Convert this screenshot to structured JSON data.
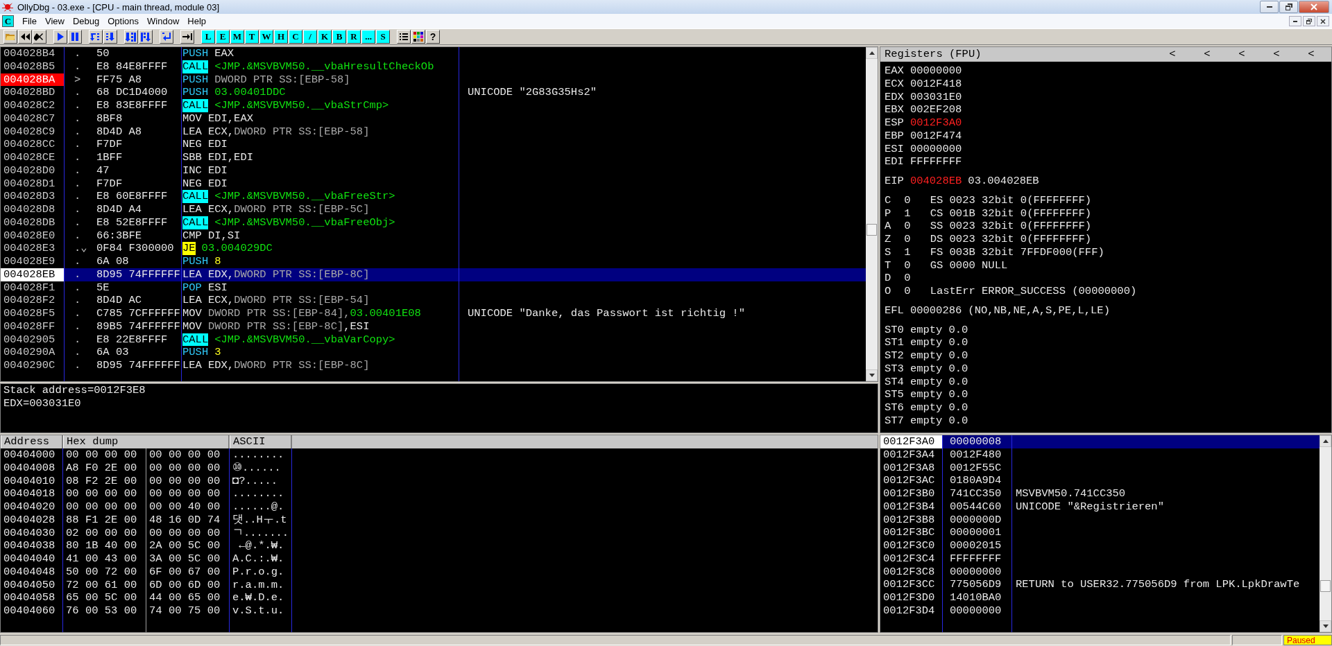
{
  "window": {
    "title": "OllyDbg - 03.exe - [CPU - main thread, module 03]"
  },
  "menu": {
    "icon_letter": "C",
    "items": [
      "File",
      "View",
      "Debug",
      "Options",
      "Window",
      "Help"
    ]
  },
  "toolbar": {
    "letters": [
      "L",
      "E",
      "M",
      "T",
      "W",
      "H",
      "C",
      "/",
      "K",
      "B",
      "R",
      "...",
      "S"
    ],
    "help": "?"
  },
  "disassembly": {
    "rows": [
      {
        "address": "004028B4",
        "marker": ".",
        "hex": "50",
        "mnemonic": "PUSH",
        "kind": "stack",
        "operands": [
          {
            "text": "EAX",
            "kind": "reg"
          }
        ],
        "breakpoint": false,
        "current": false,
        "selected": false
      },
      {
        "address": "004028B5",
        "marker": ".",
        "hex": "E8 84E8FFFF",
        "mnemonic": "CALL",
        "kind": "call",
        "operands": [
          {
            "text": "<JMP.&MSVBVM50.__vbaHresultCheckOb",
            "kind": "label"
          }
        ],
        "breakpoint": false,
        "current": false,
        "selected": false
      },
      {
        "address": "004028BA",
        "marker": ">",
        "hex": "FF75 A8",
        "mnemonic": "PUSH",
        "kind": "stack",
        "operands": [
          {
            "text": "DWORD PTR SS:[EBP-58]",
            "kind": "mem"
          }
        ],
        "breakpoint": true,
        "current": false,
        "selected": false
      },
      {
        "address": "004028BD",
        "marker": ".",
        "hex": "68 DC1D4000",
        "mnemonic": "PUSH",
        "kind": "stack",
        "operands": [
          {
            "text": "03.00401DDC",
            "kind": "label"
          }
        ],
        "comment": "UNICODE \"2G83G35Hs2\"",
        "breakpoint": false,
        "current": false,
        "selected": false
      },
      {
        "address": "004028C2",
        "marker": ".",
        "hex": "E8 83E8FFFF",
        "mnemonic": "CALL",
        "kind": "call",
        "operands": [
          {
            "text": "<JMP.&MSVBVM50.__vbaStrCmp>",
            "kind": "label"
          }
        ],
        "breakpoint": false,
        "current": false,
        "selected": false
      },
      {
        "address": "004028C7",
        "marker": ".",
        "hex": "8BF8",
        "mnemonic": "MOV",
        "kind": "plain",
        "operands": [
          {
            "text": "EDI,EAX",
            "kind": "reg"
          }
        ],
        "breakpoint": false,
        "current": false,
        "selected": false
      },
      {
        "address": "004028C9",
        "marker": ".",
        "hex": "8D4D A8",
        "mnemonic": "LEA",
        "kind": "plain",
        "operands": [
          {
            "text": "ECX,",
            "kind": "reg"
          },
          {
            "text": "DWORD PTR SS:[EBP-58]",
            "kind": "mem"
          }
        ],
        "breakpoint": false,
        "current": false,
        "selected": false
      },
      {
        "address": "004028CC",
        "marker": ".",
        "hex": "F7DF",
        "mnemonic": "NEG",
        "kind": "plain",
        "operands": [
          {
            "text": "EDI",
            "kind": "reg"
          }
        ],
        "breakpoint": false,
        "current": false,
        "selected": false
      },
      {
        "address": "004028CE",
        "marker": ".",
        "hex": "1BFF",
        "mnemonic": "SBB",
        "kind": "plain",
        "operands": [
          {
            "text": "EDI,EDI",
            "kind": "reg"
          }
        ],
        "breakpoint": false,
        "current": false,
        "selected": false
      },
      {
        "address": "004028D0",
        "marker": ".",
        "hex": "47",
        "mnemonic": "INC",
        "kind": "plain",
        "operands": [
          {
            "text": "EDI",
            "kind": "reg"
          }
        ],
        "breakpoint": false,
        "current": false,
        "selected": false
      },
      {
        "address": "004028D1",
        "marker": ".",
        "hex": "F7DF",
        "mnemonic": "NEG",
        "kind": "plain",
        "operands": [
          {
            "text": "EDI",
            "kind": "reg"
          }
        ],
        "breakpoint": false,
        "current": false,
        "selected": false
      },
      {
        "address": "004028D3",
        "marker": ".",
        "hex": "E8 60E8FFFF",
        "mnemonic": "CALL",
        "kind": "call",
        "operands": [
          {
            "text": "<JMP.&MSVBVM50.__vbaFreeStr>",
            "kind": "label"
          }
        ],
        "breakpoint": false,
        "current": false,
        "selected": false
      },
      {
        "address": "004028D8",
        "marker": ".",
        "hex": "8D4D A4",
        "mnemonic": "LEA",
        "kind": "plain",
        "operands": [
          {
            "text": "ECX,",
            "kind": "reg"
          },
          {
            "text": "DWORD PTR SS:[EBP-5C]",
            "kind": "mem"
          }
        ],
        "breakpoint": false,
        "current": false,
        "selected": false
      },
      {
        "address": "004028DB",
        "marker": ".",
        "hex": "E8 52E8FFFF",
        "mnemonic": "CALL",
        "kind": "call",
        "operands": [
          {
            "text": "<JMP.&MSVBVM50.__vbaFreeObj>",
            "kind": "label"
          }
        ],
        "breakpoint": false,
        "current": false,
        "selected": false
      },
      {
        "address": "004028E0",
        "marker": ".",
        "hex": "66:3BFE",
        "mnemonic": "CMP",
        "kind": "plain",
        "operands": [
          {
            "text": "DI,SI",
            "kind": "reg"
          }
        ],
        "breakpoint": false,
        "current": false,
        "selected": false
      },
      {
        "address": "004028E3",
        "marker": ".⌄",
        "hex": "0F84 F300000",
        "mnemonic": "JE",
        "kind": "jump",
        "operands": [
          {
            "text": "03.004029DC",
            "kind": "label"
          }
        ],
        "breakpoint": false,
        "current": false,
        "selected": false
      },
      {
        "address": "004028E9",
        "marker": ".",
        "hex": "6A 08",
        "mnemonic": "PUSH",
        "kind": "stack",
        "operands": [
          {
            "text": "8",
            "kind": "const"
          }
        ],
        "breakpoint": false,
        "current": false,
        "selected": false
      },
      {
        "address": "004028EB",
        "marker": ".",
        "hex": "8D95 74FFFFFF",
        "mnemonic": "LEA",
        "kind": "plain",
        "operands": [
          {
            "text": "EDX,",
            "kind": "reg"
          },
          {
            "text": "DWORD PTR SS:[EBP-8C]",
            "kind": "mem"
          }
        ],
        "breakpoint": false,
        "current": true,
        "selected": true
      },
      {
        "address": "004028F1",
        "marker": ".",
        "hex": "5E",
        "mnemonic": "POP",
        "kind": "stack",
        "operands": [
          {
            "text": "ESI",
            "kind": "reg"
          }
        ],
        "breakpoint": false,
        "current": false,
        "selected": false
      },
      {
        "address": "004028F2",
        "marker": ".",
        "hex": "8D4D AC",
        "mnemonic": "LEA",
        "kind": "plain",
        "operands": [
          {
            "text": "ECX,",
            "kind": "reg"
          },
          {
            "text": "DWORD PTR SS:[EBP-54]",
            "kind": "mem"
          }
        ],
        "breakpoint": false,
        "current": false,
        "selected": false
      },
      {
        "address": "004028F5",
        "marker": ".",
        "hex": "C785 7CFFFFFF",
        "mnemonic": "MOV",
        "kind": "plain",
        "operands": [
          {
            "text": "DWORD PTR SS:[EBP-84],",
            "kind": "mem"
          },
          {
            "text": "03.00401E08",
            "kind": "label"
          }
        ],
        "comment": "UNICODE \"Danke, das Passwort ist richtig !\"",
        "breakpoint": false,
        "current": false,
        "selected": false
      },
      {
        "address": "004028FF",
        "marker": ".",
        "hex": "89B5 74FFFFFF",
        "mnemonic": "MOV",
        "kind": "plain",
        "operands": [
          {
            "text": "DWORD PTR SS:[EBP-8C]",
            "kind": "mem"
          },
          {
            "text": ",ESI",
            "kind": "reg"
          }
        ],
        "breakpoint": false,
        "current": false,
        "selected": false
      },
      {
        "address": "00402905",
        "marker": ".",
        "hex": "E8 22E8FFFF",
        "mnemonic": "CALL",
        "kind": "call",
        "operands": [
          {
            "text": "<JMP.&MSVBVM50.__vbaVarCopy>",
            "kind": "label"
          }
        ],
        "breakpoint": false,
        "current": false,
        "selected": false
      },
      {
        "address": "0040290A",
        "marker": ".",
        "hex": "6A 03",
        "mnemonic": "PUSH",
        "kind": "stack",
        "operands": [
          {
            "text": "3",
            "kind": "const"
          }
        ],
        "breakpoint": false,
        "current": false,
        "selected": false
      },
      {
        "address": "0040290C",
        "marker": ".",
        "hex": "8D95 74FFFFFF",
        "mnemonic": "LEA",
        "kind": "plain",
        "operands": [
          {
            "text": "EDX,",
            "kind": "reg"
          },
          {
            "text": "DWORD PTR SS:[EBP-8C]",
            "kind": "mem"
          }
        ],
        "breakpoint": false,
        "current": false,
        "selected": false
      }
    ]
  },
  "info": [
    "Stack address=0012F3E8",
    "EDX=003031E0"
  ],
  "registers": {
    "title": "Registers (FPU)",
    "arrows": [
      "<",
      "<",
      "<",
      "<",
      "<"
    ],
    "groups": [
      {
        "kind": "general",
        "lines": [
          {
            "name": "EAX",
            "value": "00000000",
            "changed": false
          },
          {
            "name": "ECX",
            "value": "0012F418",
            "changed": false
          },
          {
            "name": "EDX",
            "value": "003031E0",
            "changed": false
          },
          {
            "name": "EBX",
            "value": "002EF208",
            "changed": false
          },
          {
            "name": "ESP",
            "value": "0012F3A0",
            "changed": true
          },
          {
            "name": "EBP",
            "value": "0012F474",
            "changed": false
          },
          {
            "name": "ESI",
            "value": "00000000",
            "changed": false
          },
          {
            "name": "EDI",
            "value": "FFFFFFFF",
            "changed": false
          }
        ]
      },
      {
        "kind": "general",
        "lines": [
          {
            "name": "EIP",
            "value": "004028EB",
            "changed": true,
            "comment": "03.004028EB"
          }
        ]
      },
      {
        "kind": "flags",
        "lines": [
          {
            "name": "C",
            "value": "0",
            "changed": false,
            "comment": "ES 0023 32bit 0(FFFFFFFF)"
          },
          {
            "name": "P",
            "value": "1",
            "changed": false,
            "comment": "CS 001B 32bit 0(FFFFFFFF)"
          },
          {
            "name": "A",
            "value": "0",
            "changed": false,
            "comment": "SS 0023 32bit 0(FFFFFFFF)"
          },
          {
            "name": "Z",
            "value": "0",
            "changed": false,
            "comment": "DS 0023 32bit 0(FFFFFFFF)"
          },
          {
            "name": "S",
            "value": "1",
            "changed": false,
            "comment": "FS 003B 32bit 7FFDF000(FFF)"
          },
          {
            "name": "T",
            "value": "0",
            "changed": false,
            "comment": "GS 0000 NULL"
          },
          {
            "name": "D",
            "value": "0",
            "changed": false
          },
          {
            "name": "O",
            "value": "0",
            "changed": false,
            "comment": "LastErr ERROR_SUCCESS (00000000)"
          }
        ]
      },
      {
        "kind": "general",
        "lines": [
          {
            "name": "EFL",
            "value": "00000286",
            "changed": false,
            "comment": "(NO,NB,NE,A,S,PE,L,LE)"
          }
        ]
      },
      {
        "kind": "general",
        "lines": [
          {
            "name": "ST0",
            "value": "empty",
            "changed": false,
            "comment": "0.0"
          },
          {
            "name": "ST1",
            "value": "empty",
            "changed": false,
            "comment": "0.0"
          },
          {
            "name": "ST2",
            "value": "empty",
            "changed": false,
            "comment": "0.0"
          },
          {
            "name": "ST3",
            "value": "empty",
            "changed": false,
            "comment": "0.0"
          },
          {
            "name": "ST4",
            "value": "empty",
            "changed": false,
            "comment": "0.0"
          },
          {
            "name": "ST5",
            "value": "empty",
            "changed": false,
            "comment": "0.0"
          },
          {
            "name": "ST6",
            "value": "empty",
            "changed": false,
            "comment": "0.0"
          },
          {
            "name": "ST7",
            "value": "empty",
            "changed": false,
            "comment": "0.0"
          }
        ]
      }
    ]
  },
  "dump": {
    "columns": [
      "Address",
      "Hex dump",
      "ASCII"
    ],
    "rows": [
      {
        "address": "00404000",
        "hex": [
          "00 00 00 00",
          "00 00 00 00"
        ],
        "ascii": "........"
      },
      {
        "address": "00404008",
        "hex": [
          "A8 F0 2E 00",
          "00 00 00 00"
        ],
        "ascii": "⑩......"
      },
      {
        "address": "00404010",
        "hex": [
          "08 F2 2E 00",
          "00 00 00 00"
        ],
        "ascii": "◘?....."
      },
      {
        "address": "00404018",
        "hex": [
          "00 00 00 00",
          "00 00 00 00"
        ],
        "ascii": "........"
      },
      {
        "address": "00404020",
        "hex": [
          "00 00 00 00",
          "00 00 40 00"
        ],
        "ascii": "......@."
      },
      {
        "address": "00404028",
        "hex": [
          "88 F1 2E 00",
          "48 16 0D 74"
        ],
        "ascii": "댓..Hㅜ.t"
      },
      {
        "address": "00404030",
        "hex": [
          "02 00 00 00",
          "00 00 00 00"
        ],
        "ascii": "ㄱ......."
      },
      {
        "address": "00404038",
        "hex": [
          "80 1B 40 00",
          "2A 00 5C 00"
        ],
        "ascii": " ←@.*.₩."
      },
      {
        "address": "00404040",
        "hex": [
          "41 00 43 00",
          "3A 00 5C 00"
        ],
        "ascii": "A.C.:.₩."
      },
      {
        "address": "00404048",
        "hex": [
          "50 00 72 00",
          "6F 00 67 00"
        ],
        "ascii": "P.r.o.g."
      },
      {
        "address": "00404050",
        "hex": [
          "72 00 61 00",
          "6D 00 6D 00"
        ],
        "ascii": "r.a.m.m."
      },
      {
        "address": "00404058",
        "hex": [
          "65 00 5C 00",
          "44 00 65 00"
        ],
        "ascii": "e.₩.D.e."
      },
      {
        "address": "00404060",
        "hex": [
          "76 00 53 00",
          "74 00 75 00"
        ],
        "ascii": "v.S.t.u."
      }
    ]
  },
  "stack": {
    "rows": [
      {
        "address": "0012F3A0",
        "value": "00000008",
        "selected": true
      },
      {
        "address": "0012F3A4",
        "value": "0012F480",
        "selected": false
      },
      {
        "address": "0012F3A8",
        "value": "0012F55C",
        "selected": false
      },
      {
        "address": "0012F3AC",
        "value": "0180A9D4",
        "selected": false
      },
      {
        "address": "0012F3B0",
        "value": "741CC350",
        "comment": "MSVBVM50.741CC350",
        "selected": false
      },
      {
        "address": "0012F3B4",
        "value": "00544C60",
        "comment": "UNICODE \"&Registrieren\"",
        "selected": false
      },
      {
        "address": "0012F3B8",
        "value": "0000000D",
        "selected": false
      },
      {
        "address": "0012F3BC",
        "value": "00000001",
        "selected": false
      },
      {
        "address": "0012F3C0",
        "value": "00002015",
        "selected": false
      },
      {
        "address": "0012F3C4",
        "value": "FFFFFFFF",
        "selected": false
      },
      {
        "address": "0012F3C8",
        "value": "00000000",
        "selected": false
      },
      {
        "address": "0012F3CC",
        "value": "775056D9",
        "comment": "RETURN to USER32.775056D9 from LPK.LpkDrawTe",
        "selected": false
      },
      {
        "address": "0012F3D0",
        "value": "14010BA0",
        "selected": false
      },
      {
        "address": "0012F3D4",
        "value": "00000000",
        "selected": false
      }
    ]
  },
  "status_bar": {
    "state": "Paused",
    "kind": "paused"
  }
}
